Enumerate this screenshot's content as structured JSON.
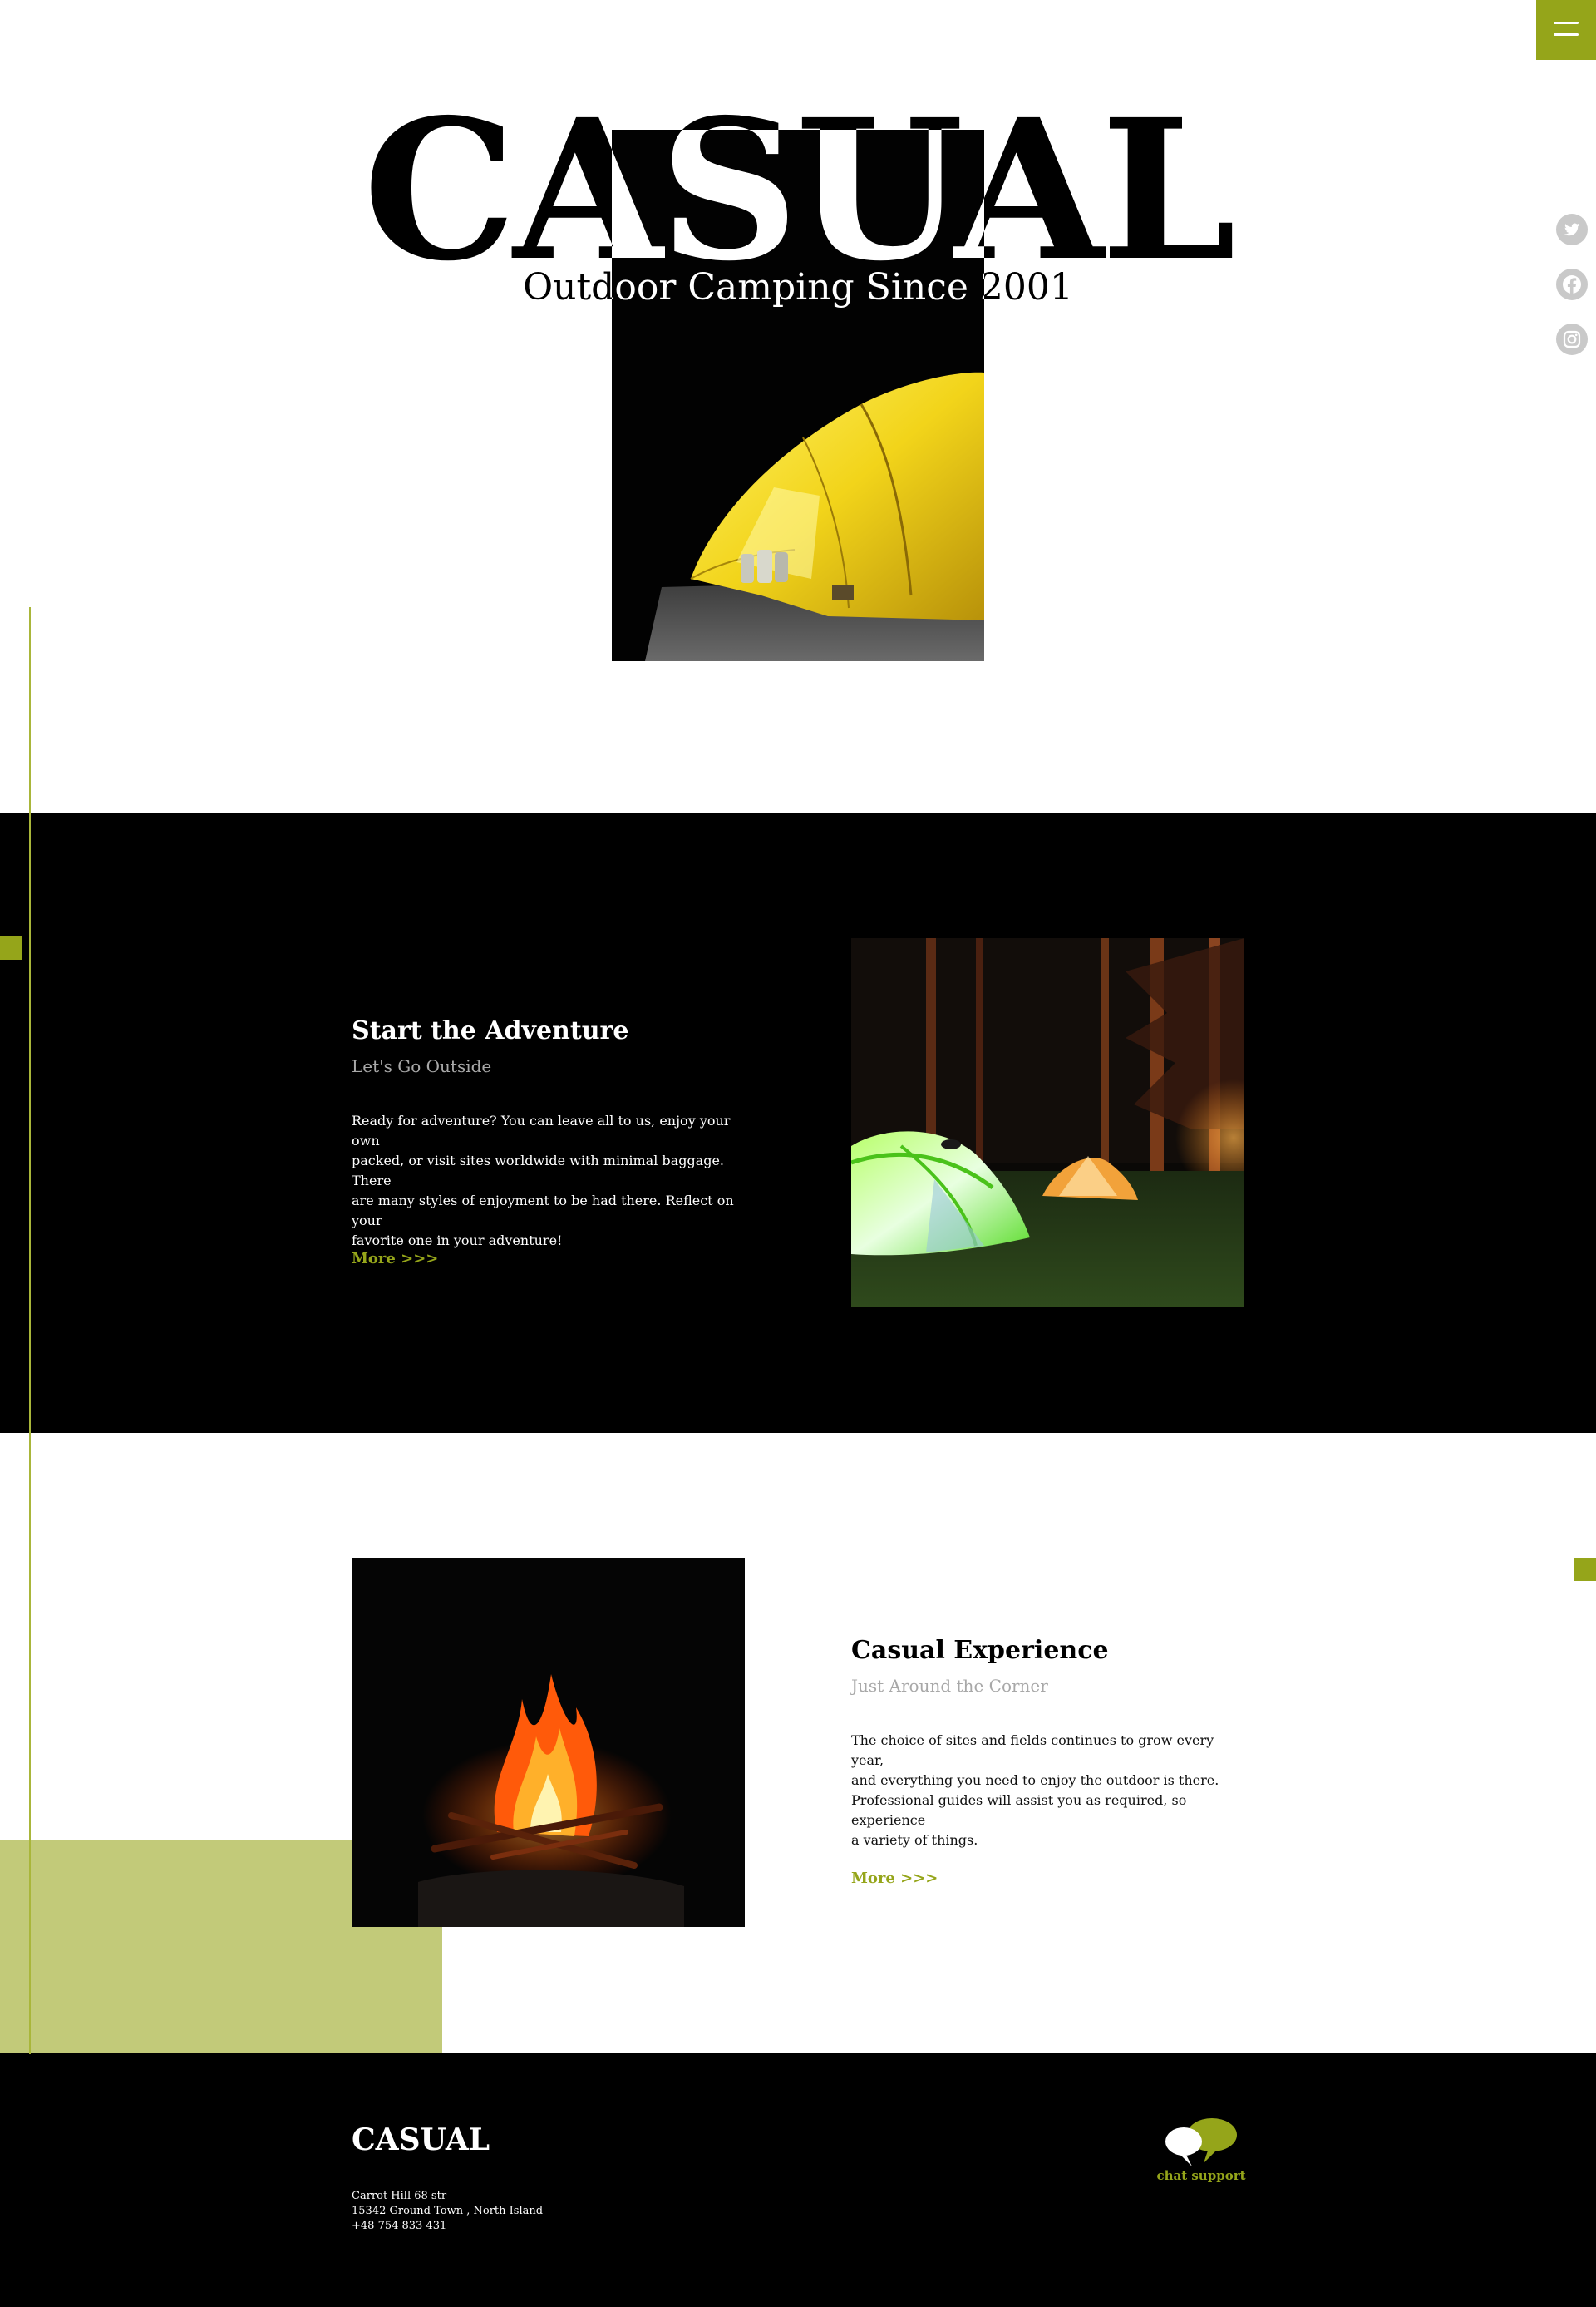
{
  "brand": {
    "accent_color": "#95a51a",
    "accent_light_color": "#c2ca79"
  },
  "header": {
    "menu_icon": "hamburger-menu-icon"
  },
  "social": {
    "items": [
      {
        "icon": "twitter-icon"
      },
      {
        "icon": "facebook-icon"
      },
      {
        "icon": "instagram-icon"
      }
    ]
  },
  "hero": {
    "title": "CASUAL",
    "subtitle": "Outdoor Camping Since 2001"
  },
  "adventure": {
    "title": "Start the Adventure",
    "subtitle": "Let's Go Outside",
    "body_lines": [
      "Ready for adventure? You can leave all to us, enjoy your own",
      "packed, or visit sites worldwide with minimal baggage. There",
      "are many styles of enjoyment to be had there. Reflect on your",
      "favorite one in your adventure!"
    ],
    "more_label": "More >>>"
  },
  "experience": {
    "title": "Casual Experience",
    "subtitle": "Just Around the Corner",
    "body_lines": [
      "The choice of sites and fields continues to grow every year,",
      "and everything you need to enjoy the outdoor is there.",
      "Professional guides will assist you as required, so experience",
      "a variety of things."
    ],
    "more_label": "More >>>"
  },
  "footer": {
    "logo": "CASUAL",
    "address_line1": "Carrot Hill 68 str",
    "address_line2": "15342 Ground Town , North Island",
    "phone": "+48 754 833 431",
    "chat_label": "chat support",
    "chat_icon": "chat-bubbles-icon"
  }
}
